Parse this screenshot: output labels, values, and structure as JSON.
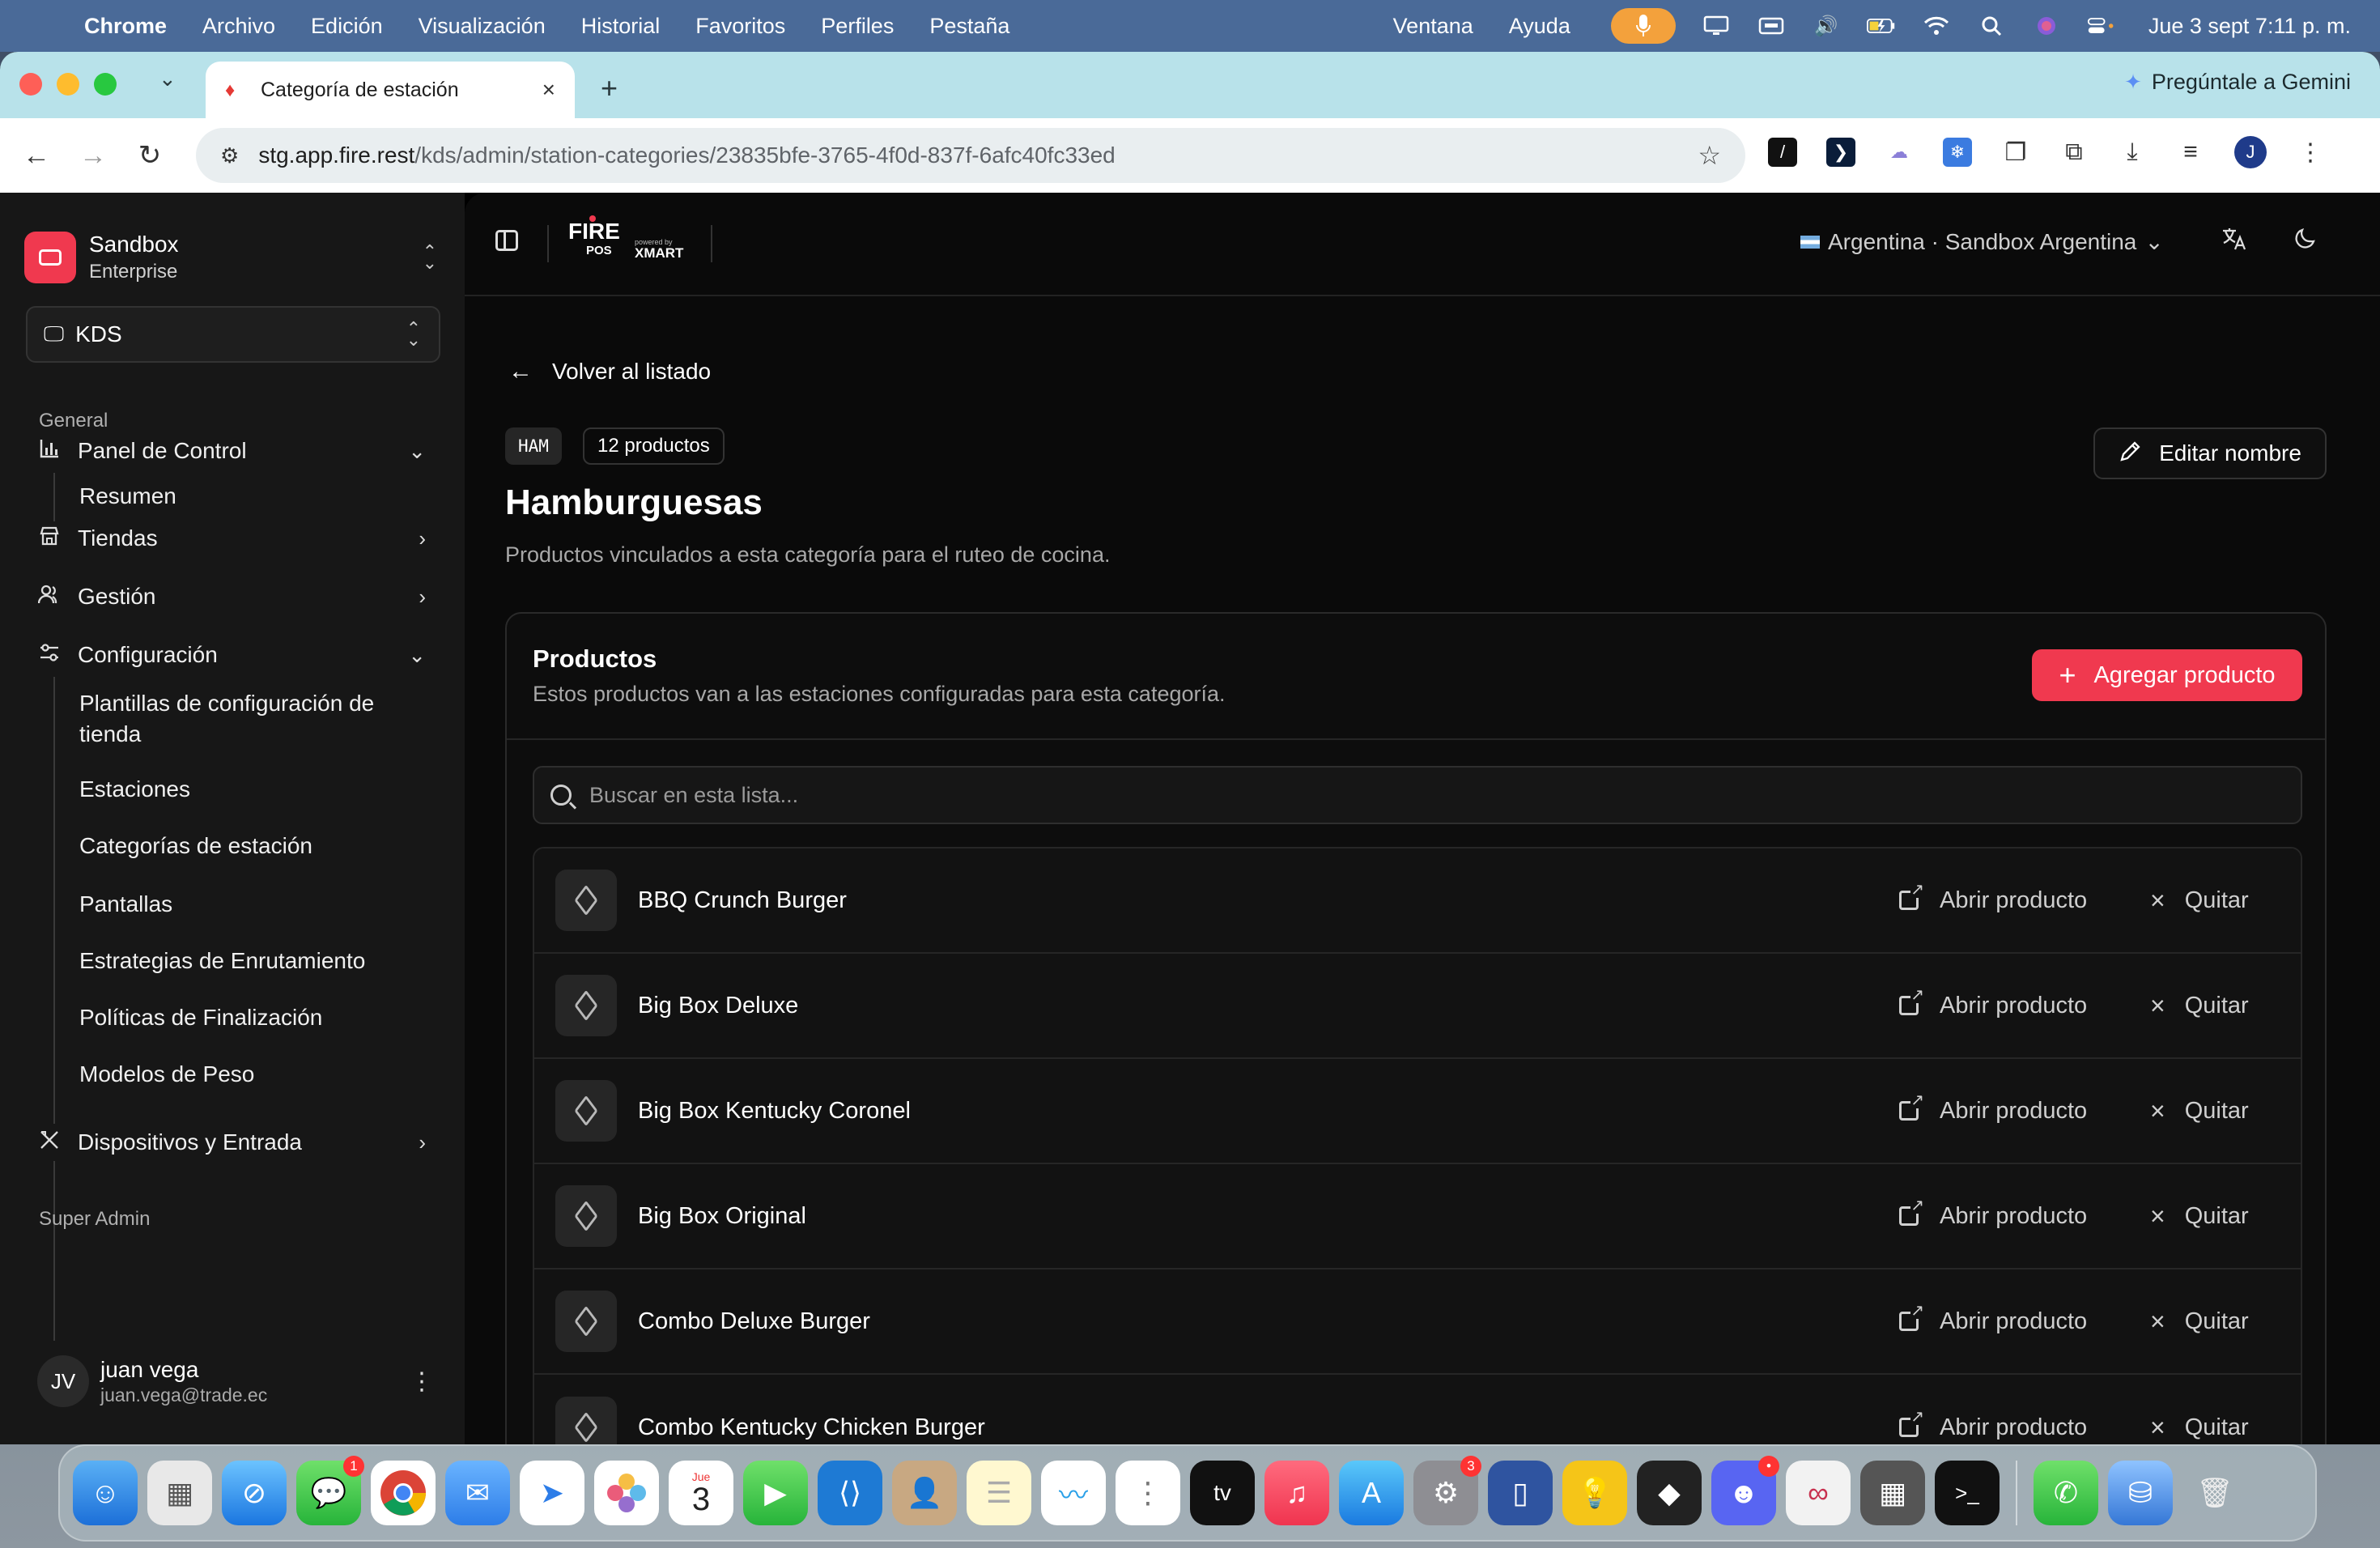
{
  "menubar": {
    "app": "Chrome",
    "items": [
      "Archivo",
      "Edición",
      "Visualización",
      "Historial",
      "Favoritos",
      "Perfiles",
      "Pestaña"
    ],
    "right_items": [
      "Ventana",
      "Ayuda"
    ],
    "clock": "Jue 3 sept  7:11 p. m."
  },
  "browser": {
    "tab_title": "Categoría de estación",
    "gemini_label": "Pregúntale a Gemini",
    "url_host": "stg.app.fire.rest",
    "url_path": "/kds/admin/station-categories/23835bfe-3765-4f0d-837f-6afc40fc33ed",
    "profile_initial": "J"
  },
  "sidebar": {
    "org_name": "Sandbox",
    "org_plan": "Enterprise",
    "module": "KDS",
    "section_general": "General",
    "section_super_admin": "Super Admin",
    "items": {
      "panel": "Panel de Control",
      "resumen": "Resumen",
      "tiendas": "Tiendas",
      "gestion": "Gestión",
      "configuracion": "Configuración",
      "plantillas": "Plantillas de configuración de tienda",
      "estaciones": "Estaciones",
      "categorias": "Categorías de estación",
      "pantallas": "Pantallas",
      "estrategias": "Estrategias de Enrutamiento",
      "politicas": "Políticas de Finalización",
      "modelos": "Modelos de Peso",
      "dispositivos": "Dispositivos y Entrada"
    },
    "user": {
      "initials": "JV",
      "name": "juan vega",
      "email": "juan.vega@trade.ec"
    }
  },
  "topbar": {
    "brand": "FIRE",
    "brand_sub": "POS",
    "powered_by": "powered by",
    "powered_brand": "XMART",
    "country": "Argentina · Sandbox Argentina"
  },
  "main": {
    "back_label": "Volver al listado",
    "badge_code": "HAM",
    "badge_count": "12 productos",
    "title": "Hamburguesas",
    "subtitle": "Productos vinculados a esta categoría para el ruteo de cocina.",
    "edit_label": "Editar nombre",
    "card_title": "Productos",
    "card_subtitle": "Estos productos van a las estaciones configuradas para esta categoría.",
    "add_label": "Agregar producto",
    "search_placeholder": "Buscar en esta lista...",
    "open_label": "Abrir producto",
    "remove_label": "Quitar",
    "products": [
      "BBQ Crunch Burger",
      "Big Box Deluxe",
      "Big Box Kentucky Coronel",
      "Big Box Original",
      "Combo Deluxe Burger",
      "Combo Kentucky Chicken Burger"
    ]
  },
  "dock": {
    "badges": {
      "messages": "1",
      "settings": "3"
    },
    "calendar_month": "Jue",
    "calendar_day": "3"
  }
}
